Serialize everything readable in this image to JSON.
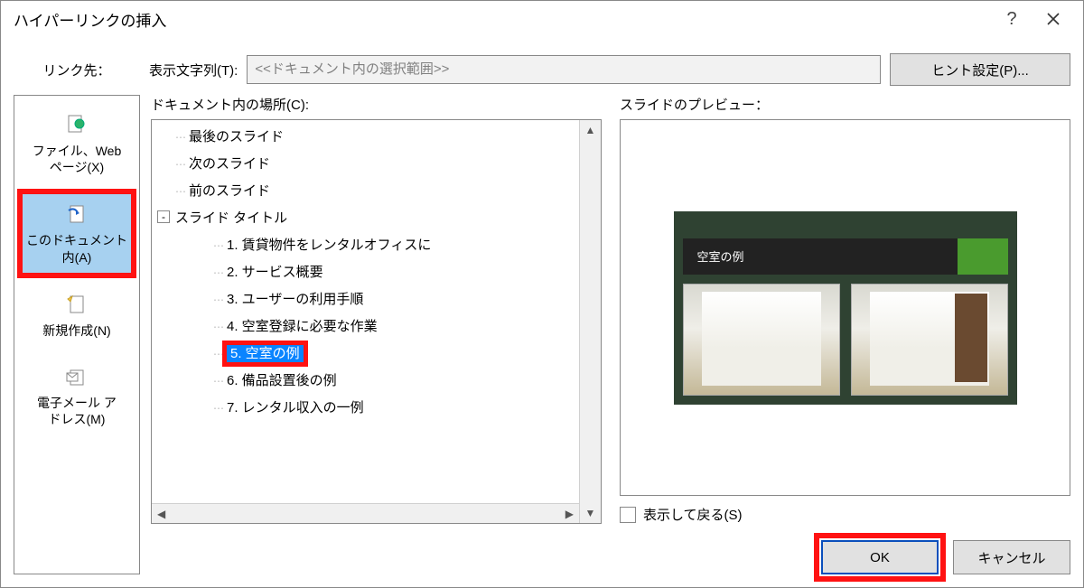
{
  "dialog_title": "ハイパーリンクの挿入",
  "row1": {
    "linkto_label": "リンク先：",
    "display_label": "表示文字列(T):",
    "display_value": "<<ドキュメント内の選択範囲>>",
    "hint_button": "ヒント設定(P)..."
  },
  "sidebar": {
    "items": [
      {
        "key": "file-web",
        "label": "ファイル、Web\nページ(X)"
      },
      {
        "key": "this-doc",
        "label": "このドキュメント\n内(A)"
      },
      {
        "key": "new-doc",
        "label": "新規作成(N)"
      },
      {
        "key": "email",
        "label": "電子メール ア\nドレス(M)"
      }
    ],
    "selected": "this-doc"
  },
  "tree": {
    "label": "ドキュメント内の場所(C):",
    "items": [
      {
        "level": 1,
        "text": "最後のスライド"
      },
      {
        "level": 1,
        "text": "次のスライド"
      },
      {
        "level": 1,
        "text": "前のスライド"
      },
      {
        "level": 1,
        "text": "スライド タイトル",
        "expander": "-"
      },
      {
        "level": 2,
        "text": "1. 賃貸物件をレンタルオフィスに"
      },
      {
        "level": 2,
        "text": "2. サービス概要"
      },
      {
        "level": 2,
        "text": "3. ユーザーの利用手順"
      },
      {
        "level": 2,
        "text": "4. 空室登録に必要な作業"
      },
      {
        "level": 2,
        "text": "5. 空室の例",
        "selected": true,
        "highlighted": true
      },
      {
        "level": 2,
        "text": "6. 備品設置後の例"
      },
      {
        "level": 2,
        "text": "7. レンタル収入の一例"
      }
    ]
  },
  "preview": {
    "label": "スライドのプレビュー：",
    "slide_title": "空室の例",
    "return_label": "表示して戻る(S)"
  },
  "footer": {
    "ok": "OK",
    "cancel": "キャンセル"
  }
}
